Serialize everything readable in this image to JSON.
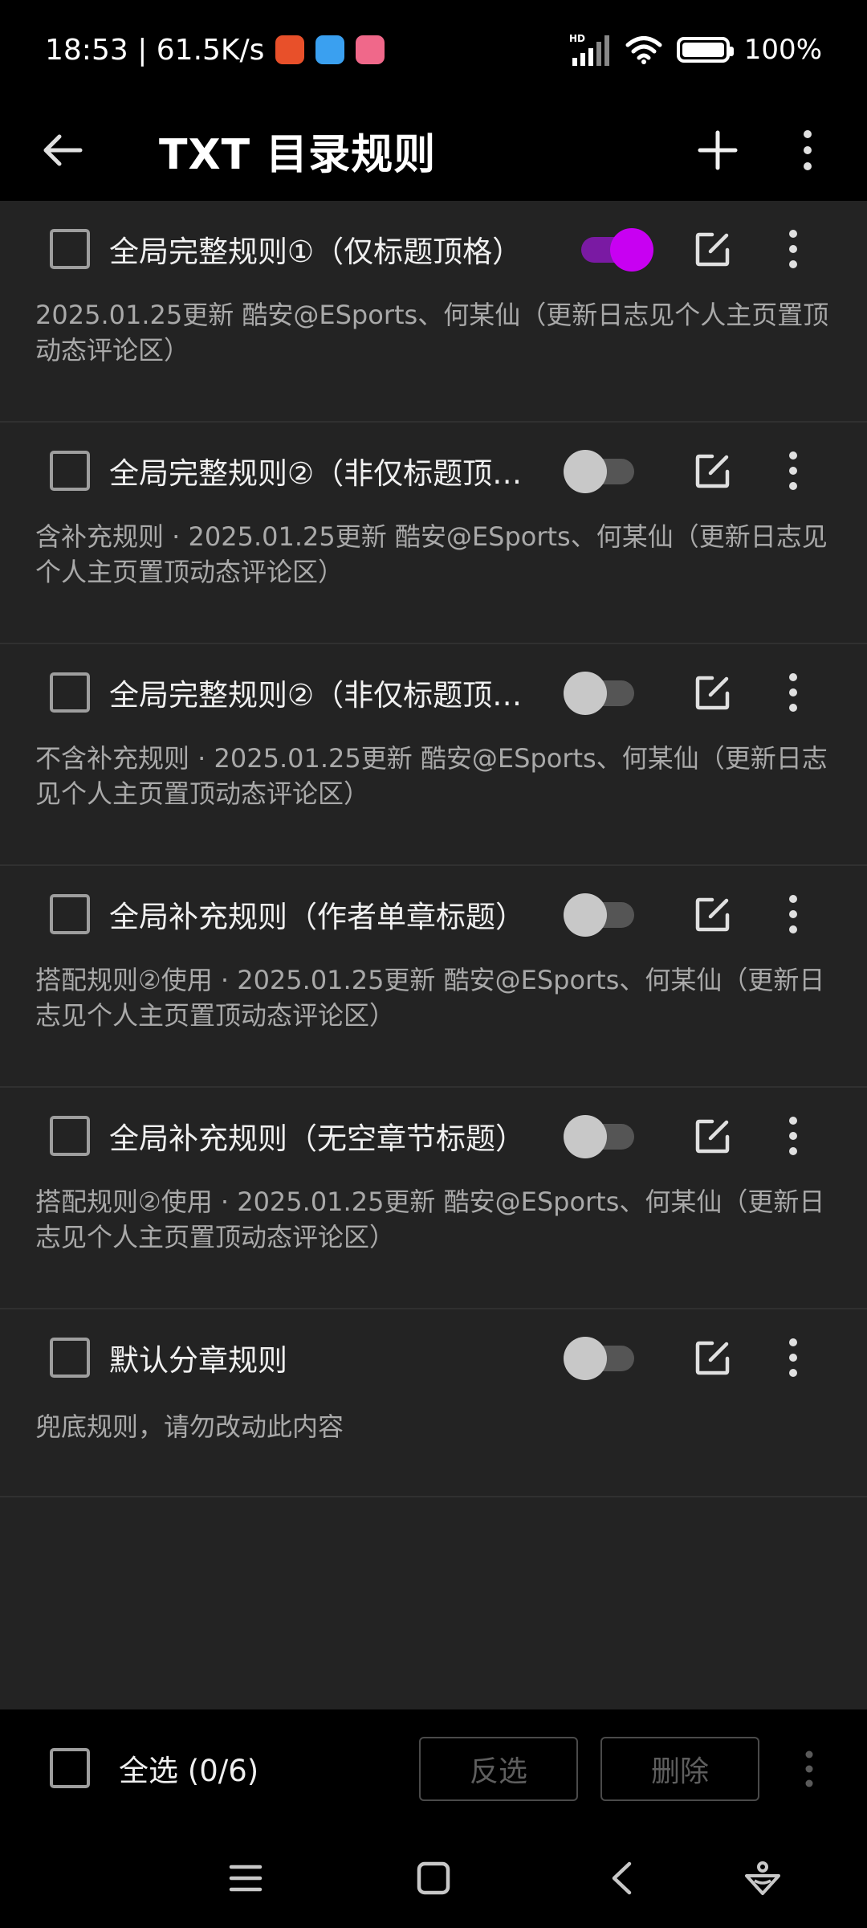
{
  "status_bar": {
    "time_speed": "18:53 | 61.5K/s",
    "network_badge": "HD",
    "battery": "100%",
    "battery_level": 1.0
  },
  "app_bar": {
    "title": "TXT 目录规则"
  },
  "rules": [
    {
      "name": "全局完整规则①（仅标题顶格）",
      "description": "2025.01.25更新  酷安@ESports、何某仙（更新日志见个人主页置顶动态评论区）",
      "enabled": true,
      "checked": false
    },
    {
      "name": "全局完整规则②（非仅标题顶…",
      "description": "含补充规则 · 2025.01.25更新  酷安@ESports、何某仙（更新日志见个人主页置顶动态评论区）",
      "enabled": false,
      "checked": false
    },
    {
      "name": "全局完整规则②（非仅标题顶…",
      "description": "不含补充规则 · 2025.01.25更新  酷安@ESports、何某仙（更新日志见个人主页置顶动态评论区）",
      "enabled": false,
      "checked": false
    },
    {
      "name": "全局补充规则（作者单章标题）",
      "description": "搭配规则②使用 · 2025.01.25更新  酷安@ESports、何某仙（更新日志见个人主页置顶动态评论区）",
      "enabled": false,
      "checked": false
    },
    {
      "name": "全局补充规则（无空章节标题）",
      "description": "搭配规则②使用 · 2025.01.25更新  酷安@ESports、何某仙（更新日志见个人主页置顶动态评论区）",
      "enabled": false,
      "checked": false
    },
    {
      "name": "默认分章规则",
      "description": "兜底规则，请勿改动此内容",
      "enabled": false,
      "checked": false
    }
  ],
  "bottom_bar": {
    "select_all_label": "全选 (0/6)",
    "invert_label": "反选",
    "delete_label": "删除"
  },
  "colors": {
    "accent": "#c800f2",
    "background": "#232323",
    "bar": "#000000"
  }
}
